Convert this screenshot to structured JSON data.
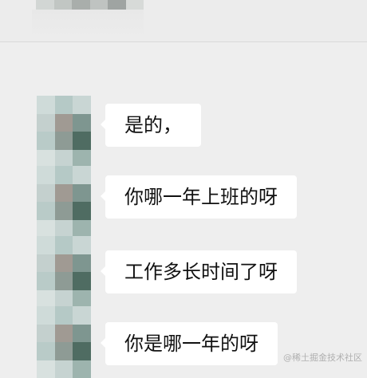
{
  "messages": [
    {
      "text": "是的，"
    },
    {
      "text": "你哪一年上班的呀"
    },
    {
      "text": "工作多长时间了呀"
    },
    {
      "text": "你是哪一年的呀"
    }
  ],
  "watermark": "@稀土掘金技术社区",
  "colors": {
    "page_background": "#eeeeee",
    "bubble_background": "#ffffff",
    "text": "#111111"
  },
  "avatar_palette": [
    "#cfdbd9",
    "#b5c9c6",
    "#c9d6d4",
    "#c4d0ce",
    "#a09a93",
    "#7e9690",
    "#b9cbc8",
    "#8e9b95",
    "#4f6c62",
    "#d8e1df",
    "#c6d3d1",
    "#9db4ae"
  ]
}
